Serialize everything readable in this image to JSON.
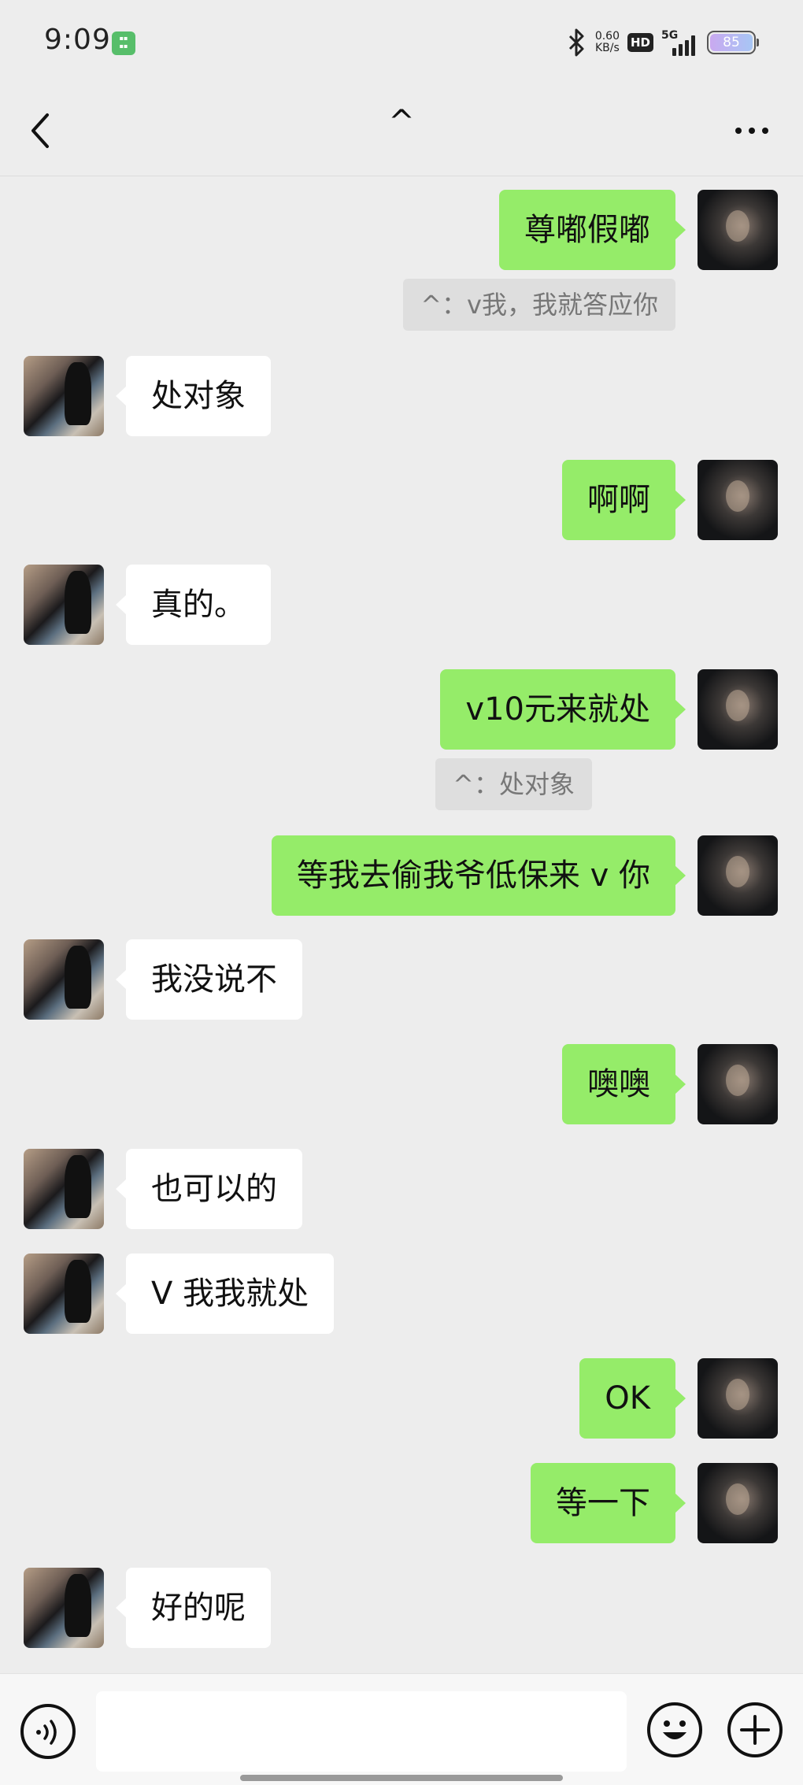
{
  "status_bar": {
    "time": "9:09",
    "net_speed_value": "0.60",
    "net_speed_unit": "KB/s",
    "hd_label": "HD",
    "network_label": "5G",
    "battery_level": "85"
  },
  "header": {
    "title": "^"
  },
  "messages": [
    {
      "side": "out",
      "text": "尊嘟假嘟"
    },
    {
      "side": "out-quote",
      "text": "^：v我，我就答应你"
    },
    {
      "side": "in",
      "text": "处对象"
    },
    {
      "side": "out",
      "text": "啊啊"
    },
    {
      "side": "in",
      "text": "真的。"
    },
    {
      "side": "out",
      "text": "v10元来就处"
    },
    {
      "side": "out-quote",
      "text": "^：处对象"
    },
    {
      "side": "out",
      "text": "等我去偷我爷低保来 v 你"
    },
    {
      "side": "in",
      "text": "我没说不"
    },
    {
      "side": "out",
      "text": "噢噢"
    },
    {
      "side": "in",
      "text": "也可以的"
    },
    {
      "side": "in",
      "text": "V 我我就处"
    },
    {
      "side": "out",
      "text": "OK"
    },
    {
      "side": "out",
      "text": "等一下"
    },
    {
      "side": "in",
      "text": "好的呢"
    }
  ],
  "input_bar": {
    "message_value": "",
    "icons": [
      "voice-icon",
      "emoji-icon",
      "plus-icon"
    ]
  },
  "colors": {
    "outgoing_bubble": "#95ec69",
    "incoming_bubble": "#ffffff",
    "background": "#ededed"
  }
}
